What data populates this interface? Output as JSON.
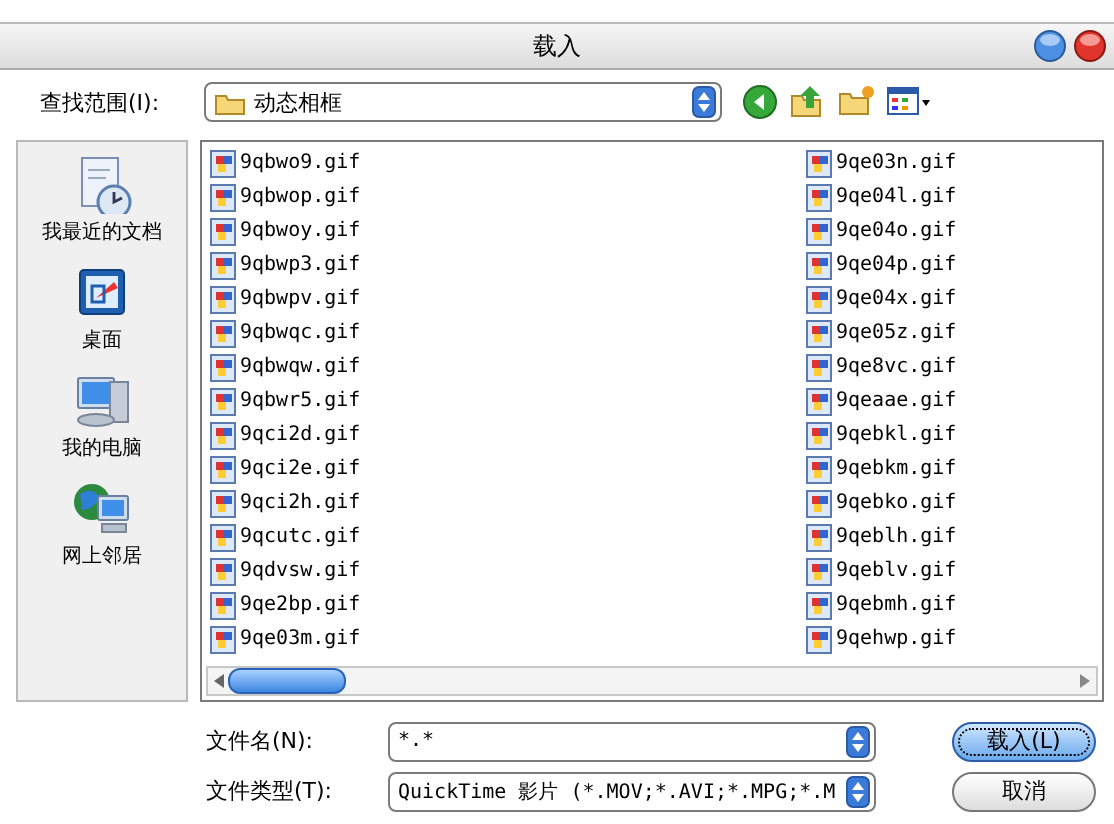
{
  "window": {
    "title": "载入"
  },
  "look_in": {
    "label": "查找范围(I):",
    "value": "动态相框"
  },
  "places": [
    {
      "kind": "recent",
      "label": "我最近的文档"
    },
    {
      "kind": "desktop",
      "label": "桌面"
    },
    {
      "kind": "computer",
      "label": "我的电脑"
    },
    {
      "kind": "network",
      "label": "网上邻居"
    }
  ],
  "file_columns": [
    [
      "9qbwo9.gif",
      "9qbwop.gif",
      "9qbwoy.gif",
      "9qbwp3.gif",
      "9qbwpv.gif",
      "9qbwqc.gif",
      "9qbwqw.gif",
      "9qbwr5.gif",
      "9qci2d.gif",
      "9qci2e.gif",
      "9qci2h.gif",
      "9qcutc.gif",
      "9qdvsw.gif",
      "9qe2bp.gif",
      "9qe03m.gif"
    ],
    [
      "9qe03n.gif",
      "9qe04l.gif",
      "9qe04o.gif",
      "9qe04p.gif",
      "9qe04x.gif",
      "9qe05z.gif",
      "9qe8vc.gif",
      "9qeaae.gif",
      "9qebkl.gif",
      "9qebkm.gif",
      "9qebko.gif",
      "9qeblh.gif",
      "9qeblv.gif",
      "9qebmh.gif",
      "9qehwp.gif"
    ]
  ],
  "file_name": {
    "label": "文件名(N):",
    "value": "*.*"
  },
  "file_type": {
    "label": "文件类型(T):",
    "value": "QuickTime 影片 (*.MOV;*.AVI;*.MPG;*.M"
  },
  "buttons": [
    {
      "label": "载入(L)",
      "default": true
    },
    {
      "label": "取消",
      "default": false
    }
  ]
}
